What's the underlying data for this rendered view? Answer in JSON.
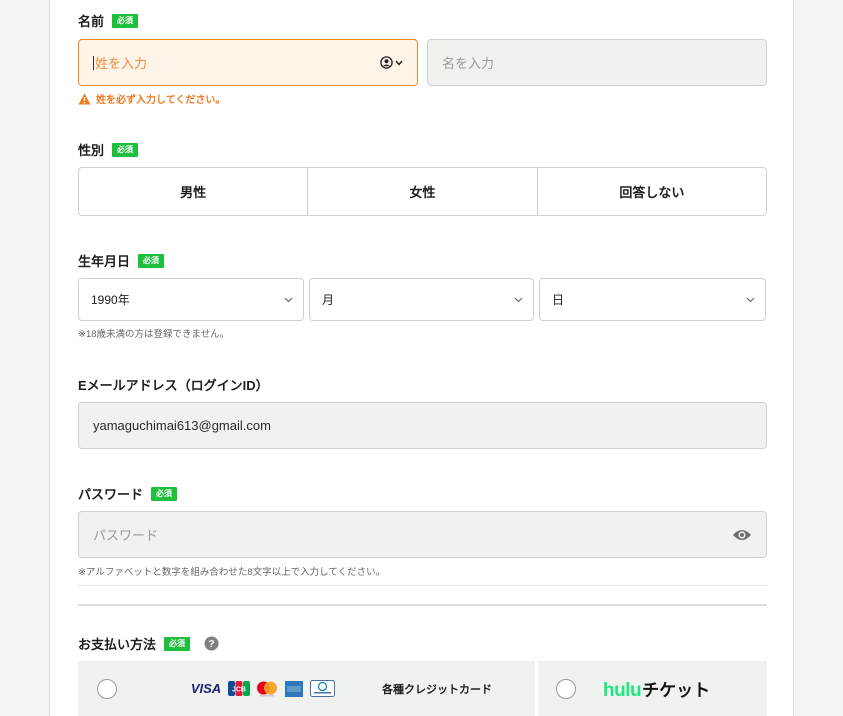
{
  "name_section": {
    "label": "名前",
    "required_badge": "必須",
    "last_name_placeholder": "姓を入力",
    "first_name_placeholder": "名を入力",
    "error_message": "姓を必ず入力してください。"
  },
  "gender_section": {
    "label": "性別",
    "required_badge": "必須",
    "options": [
      "男性",
      "女性",
      "回答しない"
    ]
  },
  "birthdate_section": {
    "label": "生年月日",
    "required_badge": "必須",
    "year_value": "1990年",
    "month_value": "月",
    "day_value": "日",
    "note": "※18歳未満の方は登録できません。"
  },
  "email_section": {
    "label": "Eメールアドレス（ログインID）",
    "value": "yamaguchimai613@gmail.com"
  },
  "password_section": {
    "label": "パスワード",
    "required_badge": "必須",
    "placeholder": "パスワード",
    "note": "※アルファベットと数字を組み合わせた8文字以上で入力してください。"
  },
  "payment_section": {
    "label": "お支払い方法",
    "required_badge": "必須",
    "credit_card_label": "各種クレジットカード",
    "card_brands": [
      "VISA",
      "JCB",
      "mastercard",
      "AMEX",
      "Diners Club"
    ],
    "hulu_logo_text": "hulu",
    "hulu_ticket_label": "チケット"
  },
  "colors": {
    "accent_green": "#1ebf3c",
    "error_orange": "#f0781e",
    "field_bg": "#f0f2ef"
  }
}
